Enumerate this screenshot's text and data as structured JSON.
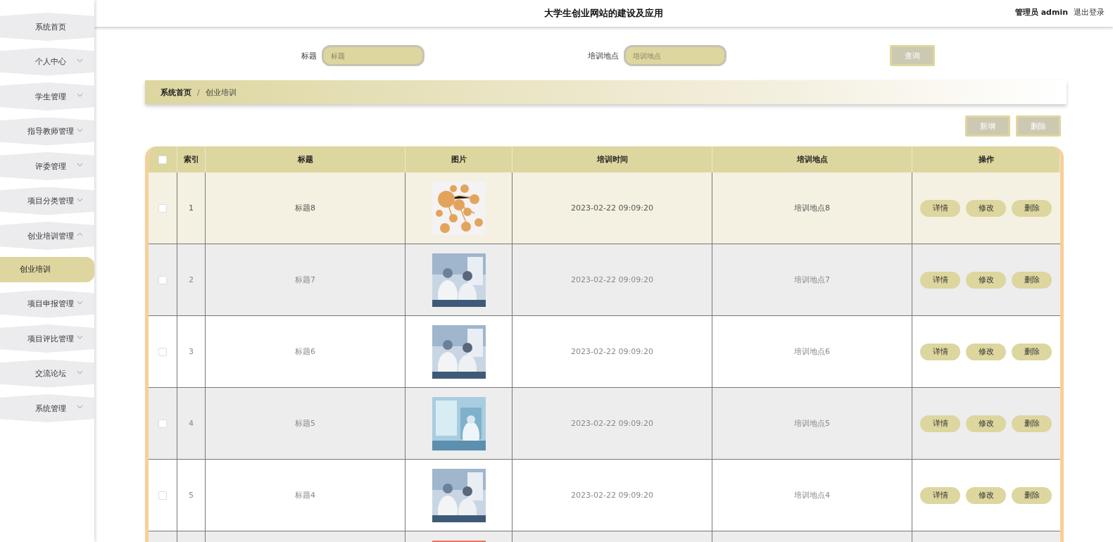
{
  "header": {
    "title": "大学生创业网站的建设及应用",
    "user": "管理员 admin",
    "logout": "退出登录"
  },
  "sidebar": {
    "items": [
      {
        "label": "系统首页",
        "expandable": false
      },
      {
        "label": "个人中心",
        "expandable": true,
        "expanded": false
      },
      {
        "label": "学生管理",
        "expandable": true,
        "expanded": false
      },
      {
        "label": "指导教师管理",
        "expandable": true,
        "expanded": false
      },
      {
        "label": "评委管理",
        "expandable": true,
        "expanded": false
      },
      {
        "label": "项目分类管理",
        "expandable": true,
        "expanded": false
      },
      {
        "label": "创业培训管理",
        "expandable": true,
        "expanded": true,
        "children": [
          {
            "label": "创业培训",
            "selected": true
          }
        ]
      },
      {
        "label": "项目申报管理",
        "expandable": true,
        "expanded": false
      },
      {
        "label": "项目评比管理",
        "expandable": true,
        "expanded": false
      },
      {
        "label": "交流论坛",
        "expandable": true,
        "expanded": false
      },
      {
        "label": "系统管理",
        "expandable": true,
        "expanded": false
      }
    ]
  },
  "search": {
    "fields": [
      {
        "label": "标题",
        "placeholder": "标题"
      },
      {
        "label": "培训地点",
        "placeholder": "培训地点"
      }
    ],
    "button": "查询"
  },
  "breadcrumb": {
    "items": [
      "系统首页",
      "创业培训"
    ],
    "separator": "/"
  },
  "actions": [
    "新增",
    "删除"
  ],
  "table": {
    "select_all": false,
    "columns": [
      "索引",
      "标题",
      "图片",
      "培训时间",
      "培训地点",
      "操作"
    ],
    "rows": [
      {
        "index": "1",
        "title": "标题8",
        "time": "2023-02-22 09:09:20",
        "place": "培训地点8",
        "buttons": [
          "详情",
          "修改",
          "删除"
        ],
        "checked": false,
        "selected": true
      },
      {
        "index": "2",
        "title": "标题7",
        "time": "2023-02-22 09:09:20",
        "place": "培训地点7",
        "buttons": [
          "详情",
          "修改",
          "删除"
        ],
        "checked": false,
        "selected": false
      },
      {
        "index": "3",
        "title": "标题6",
        "time": "2023-02-22 09:09:20",
        "place": "培训地点6",
        "buttons": [
          "详情",
          "修改",
          "删除"
        ],
        "checked": false,
        "selected": false
      },
      {
        "index": "4",
        "title": "标题5",
        "time": "2023-02-22 09:09:20",
        "place": "培训地点5",
        "buttons": [
          "详情",
          "修改",
          "删除"
        ],
        "checked": false,
        "selected": false
      },
      {
        "index": "5",
        "title": "标题4",
        "time": "2023-02-22 09:09:20",
        "place": "培训地点4",
        "buttons": [
          "详情",
          "修改",
          "删除"
        ],
        "checked": false,
        "selected": false
      },
      {
        "selected": false
      }
    ]
  }
}
